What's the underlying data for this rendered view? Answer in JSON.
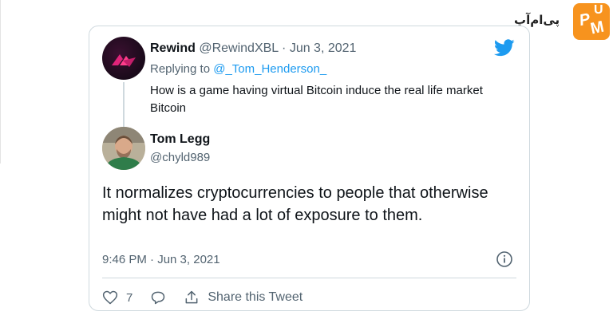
{
  "watermark": {
    "text": "پی‌ام‌آپ",
    "logo": "UpPM"
  },
  "parent_tweet": {
    "display_name": "Rewind",
    "handle": "@RewindXBL",
    "date": " · Jun 3, 2021",
    "replying_prefix": "Replying to ",
    "replying_to": "@_Tom_Henderson_",
    "text": "How is a game having virtual Bitcoin induce the real life market Bitcoin"
  },
  "main_tweet": {
    "display_name": "Tom Legg",
    "handle": "@chyld989",
    "text": "It normalizes cryptocurrencies to people that otherwise might not have had a lot of exposure to them.",
    "timestamp": "9:46 PM · Jun 3, 2021"
  },
  "actions": {
    "like_count": "7",
    "share_label": "Share this Tweet"
  },
  "colors": {
    "twitter_blue": "#1d9bf0",
    "muted": "#536471",
    "border": "#cfd9de"
  }
}
